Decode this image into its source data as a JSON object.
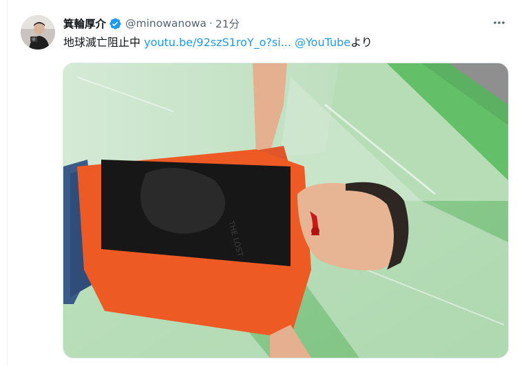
{
  "tweet": {
    "display_name": "箕輪厚介",
    "handle": "@minowanowa",
    "separator": "·",
    "time": "21分",
    "text_prefix": "地球滅亡阻止中 ",
    "link_text": "youtu.be/92szS1roY_o?si...",
    "mention": "@YouTube",
    "text_suffix": "より",
    "verified": true,
    "media_description_icon": "photo",
    "colors": {
      "link": "#1d9bf0",
      "verified": "#1d9bf0",
      "secondary_text": "#536471",
      "primary_text": "#0f1419"
    }
  },
  "icons": {
    "verified": "verified-badge-icon",
    "more": "more-dots-icon"
  }
}
